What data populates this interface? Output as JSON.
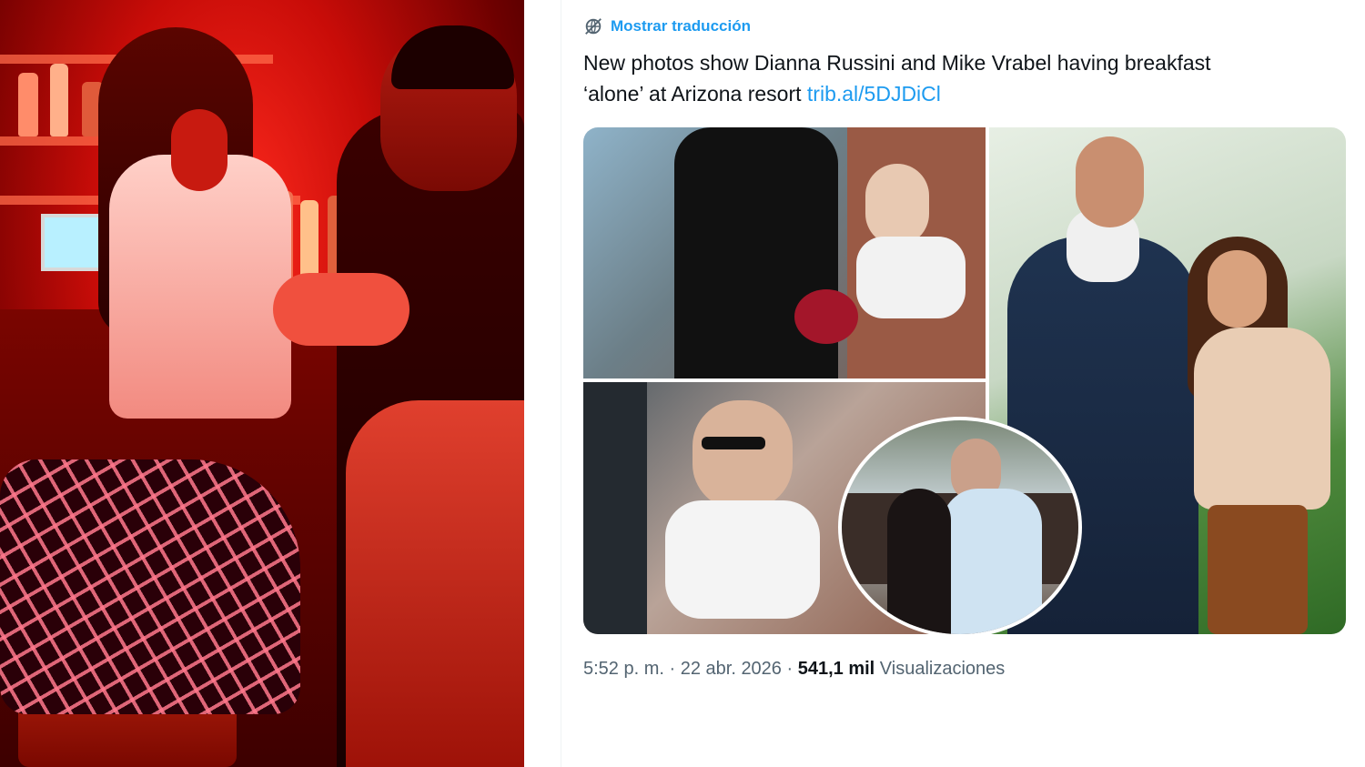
{
  "tweet": {
    "translate_label": "Mostrar traducción",
    "text_line1": "New photos show Dianna Russini and Mike Vrabel having breakfast",
    "text_line2": "‘alone’ at Arizona resort ",
    "link": "trib.al/5DJDiCl",
    "time": "5:52 p. m.",
    "separator1": " · ",
    "date": "22 abr. 2026",
    "separator2": " · ",
    "views_count": "541,1 mil",
    "views_label": " Visualizaciones"
  },
  "colors": {
    "link": "#1d9bf0",
    "text": "#0f1419",
    "meta": "#536471"
  },
  "icons": {
    "translate": "globe-slash-icon"
  }
}
